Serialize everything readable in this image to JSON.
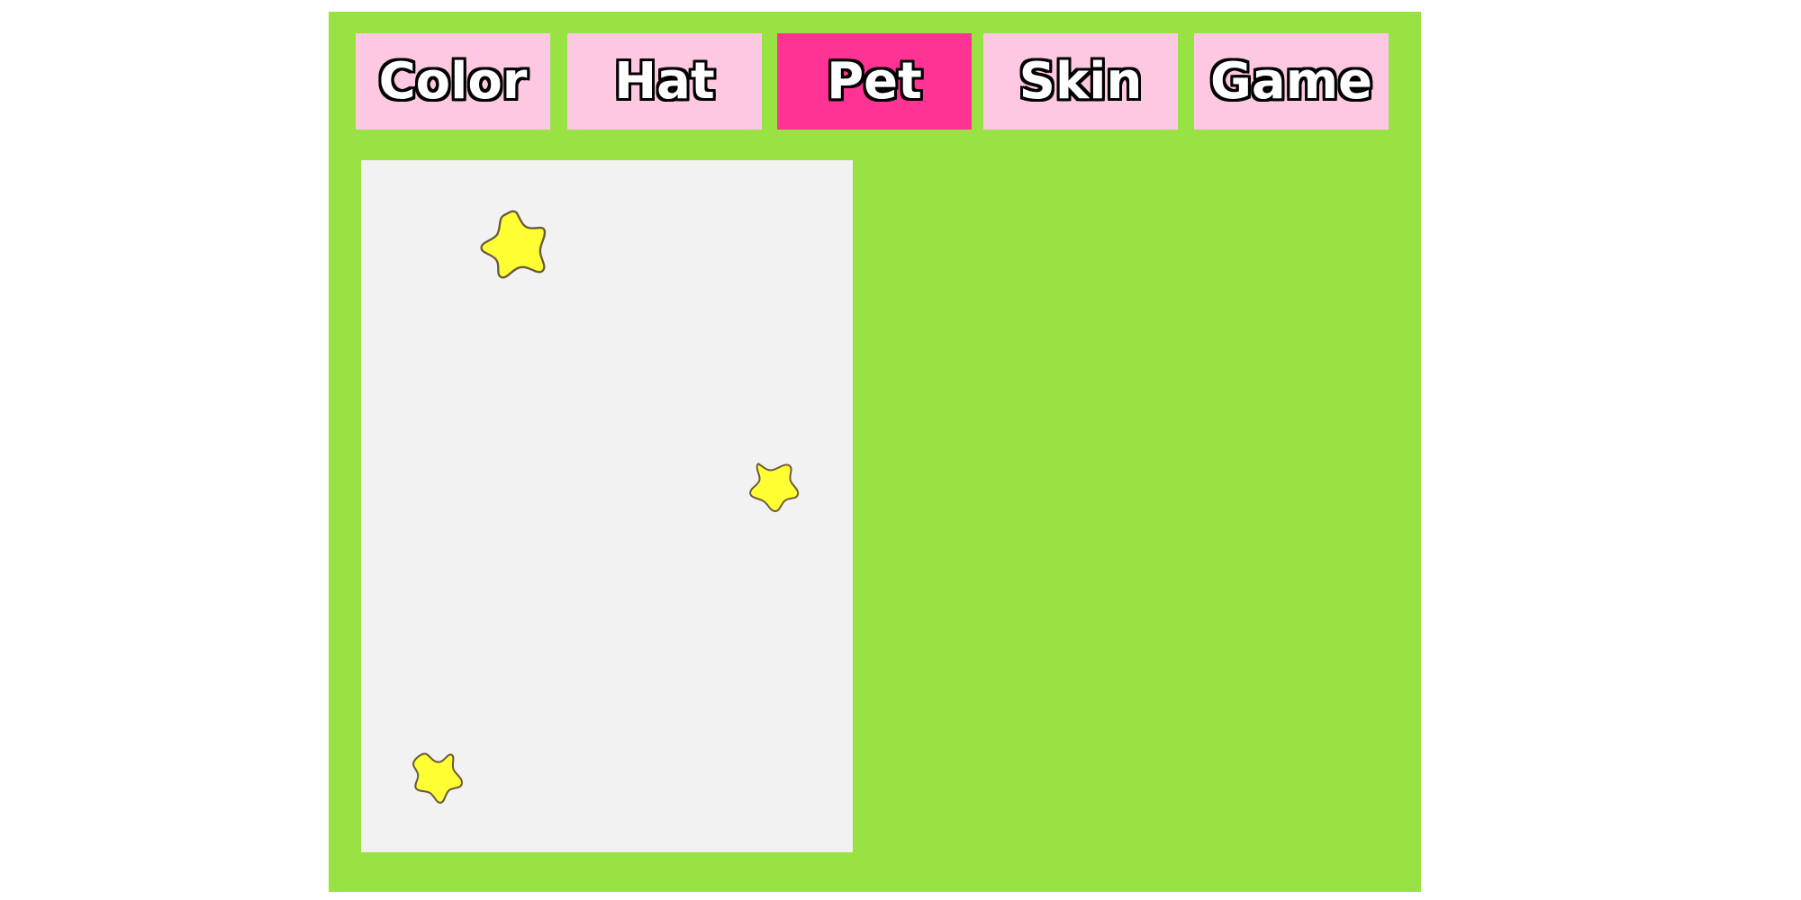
{
  "tabs": [
    {
      "label": "Color",
      "active": false
    },
    {
      "label": "Hat",
      "active": false
    },
    {
      "label": "Pet",
      "active": true
    },
    {
      "label": "Skin",
      "active": false
    },
    {
      "label": "Game",
      "active": false
    }
  ],
  "colors": {
    "background": "#98e244",
    "tab": "#fec8e3",
    "tab_active": "#fe3393",
    "pet_area": "#f2f2f2",
    "star_fill": "#ffff33",
    "star_outline": "#6b5a3a"
  },
  "pets": [
    {
      "icon": "star-icon"
    },
    {
      "icon": "star-icon"
    },
    {
      "icon": "star-icon"
    }
  ]
}
